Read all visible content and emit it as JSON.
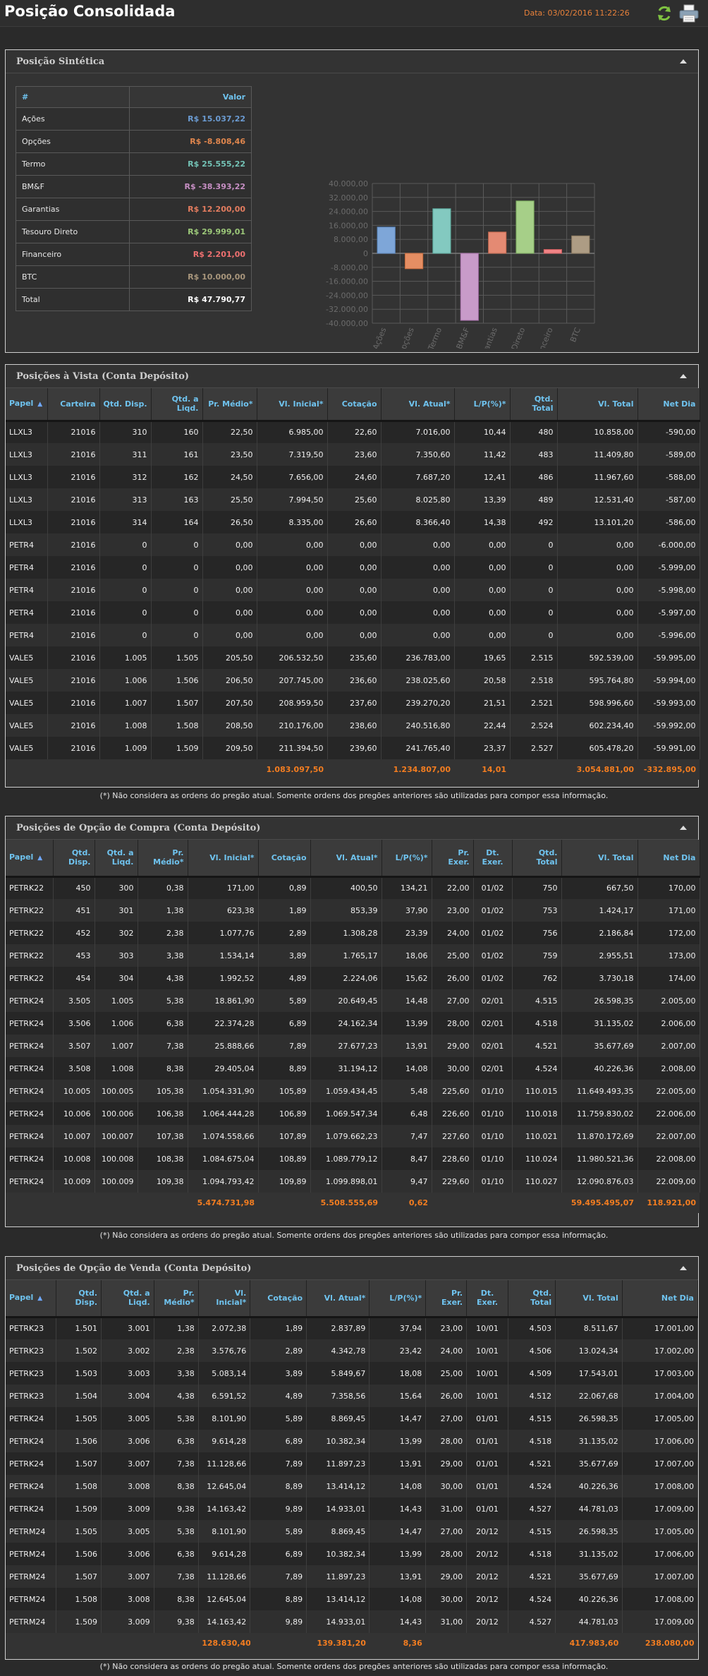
{
  "header": {
    "title": "Posição Consolidada",
    "date": "Data: 03/02/2016 11:22:26"
  },
  "note": "(*) Não considera as ordens do pregão atual. Somente ordens dos pregões anteriores são utilizadas para compor essa informação.",
  "sintetica": {
    "title": "Posição Sintética",
    "col_name": "#",
    "col_value": "Valor",
    "rows": [
      {
        "label": "Ações",
        "value": "R$ 15.037,22",
        "color": "#6b9bd2"
      },
      {
        "label": "Opções",
        "value": "R$ -8.808,46",
        "color": "#e0864d"
      },
      {
        "label": "Termo",
        "value": "R$ 25.555,22",
        "color": "#73c2b5"
      },
      {
        "label": "BM&F",
        "value": "R$ -38.393,22",
        "color": "#c78fc4"
      },
      {
        "label": "Garantias",
        "value": "R$ 12.200,00",
        "color": "#e37c5f"
      },
      {
        "label": "Tesouro Direto",
        "value": "R$ 29.999,01",
        "color": "#9cc879"
      },
      {
        "label": "Financeiro",
        "value": "R$ 2.201,00",
        "color": "#ee7070"
      },
      {
        "label": "BTC",
        "value": "R$ 10.000,00",
        "color": "#a8967c"
      },
      {
        "label": "Total",
        "value": "R$ 47.790,77",
        "color": "#ffffff"
      }
    ]
  },
  "chart_data": {
    "type": "bar",
    "categories": [
      "Ações",
      "Opções",
      "Termo",
      "BM&F",
      "Garantias",
      "Tesouro Direto",
      "Financeiro",
      "BTC"
    ],
    "values": [
      15037.22,
      -8808.46,
      25555.22,
      -38393.22,
      12200.0,
      29999.01,
      2201.0,
      10000.0
    ],
    "fills": [
      "#7ea6d8",
      "#e58e63",
      "#83c9c0",
      "#c89bc9",
      "#e48a73",
      "#a6cf88",
      "#f08486",
      "#ad9c84"
    ],
    "strokes": [
      "#5a86bd",
      "#c46a3c",
      "#5aa89b",
      "#a26ca4",
      "#c0654c",
      "#7aa85d",
      "#cf5b5d",
      "#8c7a5f"
    ],
    "yticks": [
      "40.000,00",
      "32.000,00",
      "24.000,00",
      "16.000,00",
      "8.000,00",
      "0",
      "-8.000,00",
      "-16.000,00",
      "-24.000,00",
      "-32.000,00",
      "-40.000,00"
    ],
    "ylim": [
      -40000,
      40000
    ],
    "grid": true
  },
  "vista": {
    "title": "Posições à Vista (Conta Depósito)",
    "cols": [
      "Papel",
      "Carteira",
      "Qtd. Disp.",
      "Qtd. a Liqd.",
      "Pr. Médio*",
      "Vl. Inicial*",
      "Cotação",
      "Vl. Atual*",
      "L/P(%)*",
      "Qtd. Total",
      "Vl. Total",
      "Net Dia"
    ],
    "rows": [
      [
        "LLXL3",
        "21016",
        "310",
        "160",
        "22,50",
        "6.985,00",
        "22,60",
        "7.016,00",
        "10,44",
        "480",
        "10.858,00",
        "-590,00"
      ],
      [
        "LLXL3",
        "21016",
        "311",
        "161",
        "23,50",
        "7.319,50",
        "23,60",
        "7.350,60",
        "11,42",
        "483",
        "11.409,80",
        "-589,00"
      ],
      [
        "LLXL3",
        "21016",
        "312",
        "162",
        "24,50",
        "7.656,00",
        "24,60",
        "7.687,20",
        "12,41",
        "486",
        "11.967,60",
        "-588,00"
      ],
      [
        "LLXL3",
        "21016",
        "313",
        "163",
        "25,50",
        "7.994,50",
        "25,60",
        "8.025,80",
        "13,39",
        "489",
        "12.531,40",
        "-587,00"
      ],
      [
        "LLXL3",
        "21016",
        "314",
        "164",
        "26,50",
        "8.335,00",
        "26,60",
        "8.366,40",
        "14,38",
        "492",
        "13.101,20",
        "-586,00"
      ],
      [
        "PETR4",
        "21016",
        "0",
        "0",
        "0,00",
        "0,00",
        "0,00",
        "0,00",
        "0,00",
        "0",
        "0,00",
        "-6.000,00"
      ],
      [
        "PETR4",
        "21016",
        "0",
        "0",
        "0,00",
        "0,00",
        "0,00",
        "0,00",
        "0,00",
        "0",
        "0,00",
        "-5.999,00"
      ],
      [
        "PETR4",
        "21016",
        "0",
        "0",
        "0,00",
        "0,00",
        "0,00",
        "0,00",
        "0,00",
        "0",
        "0,00",
        "-5.998,00"
      ],
      [
        "PETR4",
        "21016",
        "0",
        "0",
        "0,00",
        "0,00",
        "0,00",
        "0,00",
        "0,00",
        "0",
        "0,00",
        "-5.997,00"
      ],
      [
        "PETR4",
        "21016",
        "0",
        "0",
        "0,00",
        "0,00",
        "0,00",
        "0,00",
        "0,00",
        "0",
        "0,00",
        "-5.996,00"
      ],
      [
        "VALE5",
        "21016",
        "1.005",
        "1.505",
        "205,50",
        "206.532,50",
        "235,60",
        "236.783,00",
        "19,65",
        "2.515",
        "592.539,00",
        "-59.995,00"
      ],
      [
        "VALE5",
        "21016",
        "1.006",
        "1.506",
        "206,50",
        "207.745,00",
        "236,60",
        "238.025,60",
        "20,58",
        "2.518",
        "595.764,80",
        "-59.994,00"
      ],
      [
        "VALE5",
        "21016",
        "1.007",
        "1.507",
        "207,50",
        "208.959,50",
        "237,60",
        "239.270,20",
        "21,51",
        "2.521",
        "598.996,60",
        "-59.993,00"
      ],
      [
        "VALE5",
        "21016",
        "1.008",
        "1.508",
        "208,50",
        "210.176,00",
        "238,60",
        "240.516,80",
        "22,44",
        "2.524",
        "602.234,40",
        "-59.992,00"
      ],
      [
        "VALE5",
        "21016",
        "1.009",
        "1.509",
        "209,50",
        "211.394,50",
        "239,60",
        "241.765,40",
        "23,37",
        "2.527",
        "605.478,20",
        "-59.991,00"
      ]
    ],
    "totals": [
      "",
      "",
      "",
      "",
      "",
      "1.083.097,50",
      "",
      "1.234.807,00",
      "14,01",
      "",
      "3.054.881,00",
      "-332.895,00"
    ]
  },
  "compra": {
    "title": "Posições de Opção de Compra (Conta Depósito)",
    "cols": [
      "Papel",
      "Qtd. Disp.",
      "Qtd. a Liqd.",
      "Pr. Médio*",
      "Vl. Inicial*",
      "Cotação",
      "Vl. Atual*",
      "L/P(%)*",
      "Pr. Exer.",
      "Dt. Exer.",
      "Qtd. Total",
      "Vl. Total",
      "Net Dia"
    ],
    "rows": [
      [
        "PETRK22",
        "450",
        "300",
        "0,38",
        "171,00",
        "0,89",
        "400,50",
        "134,21",
        "22,00",
        "01/02",
        "750",
        "667,50",
        "170,00"
      ],
      [
        "PETRK22",
        "451",
        "301",
        "1,38",
        "623,38",
        "1,89",
        "853,39",
        "37,90",
        "23,00",
        "01/02",
        "753",
        "1.424,17",
        "171,00"
      ],
      [
        "PETRK22",
        "452",
        "302",
        "2,38",
        "1.077,76",
        "2,89",
        "1.308,28",
        "23,39",
        "24,00",
        "01/02",
        "756",
        "2.186,84",
        "172,00"
      ],
      [
        "PETRK22",
        "453",
        "303",
        "3,38",
        "1.534,14",
        "3,89",
        "1.765,17",
        "18,06",
        "25,00",
        "01/02",
        "759",
        "2.955,51",
        "173,00"
      ],
      [
        "PETRK22",
        "454",
        "304",
        "4,38",
        "1.992,52",
        "4,89",
        "2.224,06",
        "15,62",
        "26,00",
        "01/02",
        "762",
        "3.730,18",
        "174,00"
      ],
      [
        "PETRK24",
        "3.505",
        "1.005",
        "5,38",
        "18.861,90",
        "5,89",
        "20.649,45",
        "14,48",
        "27,00",
        "02/01",
        "4.515",
        "26.598,35",
        "2.005,00"
      ],
      [
        "PETRK24",
        "3.506",
        "1.006",
        "6,38",
        "22.374,28",
        "6,89",
        "24.162,34",
        "13,99",
        "28,00",
        "02/01",
        "4.518",
        "31.135,02",
        "2.006,00"
      ],
      [
        "PETRK24",
        "3.507",
        "1.007",
        "7,38",
        "25.888,66",
        "7,89",
        "27.677,23",
        "13,91",
        "29,00",
        "02/01",
        "4.521",
        "35.677,69",
        "2.007,00"
      ],
      [
        "PETRK24",
        "3.508",
        "1.008",
        "8,38",
        "29.405,04",
        "8,89",
        "31.194,12",
        "14,08",
        "30,00",
        "02/01",
        "4.524",
        "40.226,36",
        "2.008,00"
      ],
      [
        "PETRK24",
        "10.005",
        "100.005",
        "105,38",
        "1.054.331,90",
        "105,89",
        "1.059.434,45",
        "5,48",
        "225,60",
        "01/10",
        "110.015",
        "11.649.493,35",
        "22.005,00"
      ],
      [
        "PETRK24",
        "10.006",
        "100.006",
        "106,38",
        "1.064.444,28",
        "106,89",
        "1.069.547,34",
        "6,48",
        "226,60",
        "01/10",
        "110.018",
        "11.759.830,02",
        "22.006,00"
      ],
      [
        "PETRK24",
        "10.007",
        "100.007",
        "107,38",
        "1.074.558,66",
        "107,89",
        "1.079.662,23",
        "7,47",
        "227,60",
        "01/10",
        "110.021",
        "11.870.172,69",
        "22.007,00"
      ],
      [
        "PETRK24",
        "10.008",
        "100.008",
        "108,38",
        "1.084.675,04",
        "108,89",
        "1.089.779,12",
        "8,47",
        "228,60",
        "01/10",
        "110.024",
        "11.980.521,36",
        "22.008,00"
      ],
      [
        "PETRK24",
        "10.009",
        "100.009",
        "109,38",
        "1.094.793,42",
        "109,89",
        "1.099.898,01",
        "9,47",
        "229,60",
        "01/10",
        "110.027",
        "12.090.876,03",
        "22.009,00"
      ]
    ],
    "totals": [
      "",
      "",
      "",
      "",
      "5.474.731,98",
      "",
      "5.508.555,69",
      "0,62",
      "",
      "",
      "",
      "59.495.495,07",
      "118.921,00"
    ]
  },
  "venda": {
    "title": "Posições de Opção de Venda (Conta Depósito)",
    "cols": [
      "Papel",
      "Qtd. Disp.",
      "Qtd. a Liqd.",
      "Pr. Médio*",
      "Vl. Inicial*",
      "Cotação",
      "Vl. Atual*",
      "L/P(%)*",
      "Pr. Exer.",
      "Dt. Exer.",
      "Qtd. Total",
      "Vl. Total",
      "Net Dia"
    ],
    "rows": [
      [
        "PETRK23",
        "1.501",
        "3.001",
        "1,38",
        "2.072,38",
        "1,89",
        "2.837,89",
        "37,94",
        "23,00",
        "10/01",
        "4.503",
        "8.511,67",
        "17.001,00"
      ],
      [
        "PETRK23",
        "1.502",
        "3.002",
        "2,38",
        "3.576,76",
        "2,89",
        "4.342,78",
        "23,42",
        "24,00",
        "10/01",
        "4.506",
        "13.024,34",
        "17.002,00"
      ],
      [
        "PETRK23",
        "1.503",
        "3.003",
        "3,38",
        "5.083,14",
        "3,89",
        "5.849,67",
        "18,08",
        "25,00",
        "10/01",
        "4.509",
        "17.543,01",
        "17.003,00"
      ],
      [
        "PETRK23",
        "1.504",
        "3.004",
        "4,38",
        "6.591,52",
        "4,89",
        "7.358,56",
        "15,64",
        "26,00",
        "10/01",
        "4.512",
        "22.067,68",
        "17.004,00"
      ],
      [
        "PETRK24",
        "1.505",
        "3.005",
        "5,38",
        "8.101,90",
        "5,89",
        "8.869,45",
        "14,47",
        "27,00",
        "01/01",
        "4.515",
        "26.598,35",
        "17.005,00"
      ],
      [
        "PETRK24",
        "1.506",
        "3.006",
        "6,38",
        "9.614,28",
        "6,89",
        "10.382,34",
        "13,99",
        "28,00",
        "01/01",
        "4.518",
        "31.135,02",
        "17.006,00"
      ],
      [
        "PETRK24",
        "1.507",
        "3.007",
        "7,38",
        "11.128,66",
        "7,89",
        "11.897,23",
        "13,91",
        "29,00",
        "01/01",
        "4.521",
        "35.677,69",
        "17.007,00"
      ],
      [
        "PETRK24",
        "1.508",
        "3.008",
        "8,38",
        "12.645,04",
        "8,89",
        "13.414,12",
        "14,08",
        "30,00",
        "01/01",
        "4.524",
        "40.226,36",
        "17.008,00"
      ],
      [
        "PETRK24",
        "1.509",
        "3.009",
        "9,38",
        "14.163,42",
        "9,89",
        "14.933,01",
        "14,43",
        "31,00",
        "01/01",
        "4.527",
        "44.781,03",
        "17.009,00"
      ],
      [
        "PETRM24",
        "1.505",
        "3.005",
        "5,38",
        "8.101,90",
        "5,89",
        "8.869,45",
        "14,47",
        "27,00",
        "20/12",
        "4.515",
        "26.598,35",
        "17.005,00"
      ],
      [
        "PETRM24",
        "1.506",
        "3.006",
        "6,38",
        "9.614,28",
        "6,89",
        "10.382,34",
        "13,99",
        "28,00",
        "20/12",
        "4.518",
        "31.135,02",
        "17.006,00"
      ],
      [
        "PETRM24",
        "1.507",
        "3.007",
        "7,38",
        "11.128,66",
        "7,89",
        "11.897,23",
        "13,91",
        "29,00",
        "20/12",
        "4.521",
        "35.677,69",
        "17.007,00"
      ],
      [
        "PETRM24",
        "1.508",
        "3.008",
        "8,38",
        "12.645,04",
        "8,89",
        "13.414,12",
        "14,08",
        "30,00",
        "20/12",
        "4.524",
        "40.226,36",
        "17.008,00"
      ],
      [
        "PETRM24",
        "1.509",
        "3.009",
        "9,38",
        "14.163,42",
        "9,89",
        "14.933,01",
        "14,43",
        "31,00",
        "20/12",
        "4.527",
        "44.781,03",
        "17.009,00"
      ]
    ],
    "totals": [
      "",
      "",
      "",
      "",
      "128.630,40",
      "",
      "139.381,20",
      "8,36",
      "",
      "",
      "",
      "417.983,60",
      "238.080,00"
    ]
  }
}
